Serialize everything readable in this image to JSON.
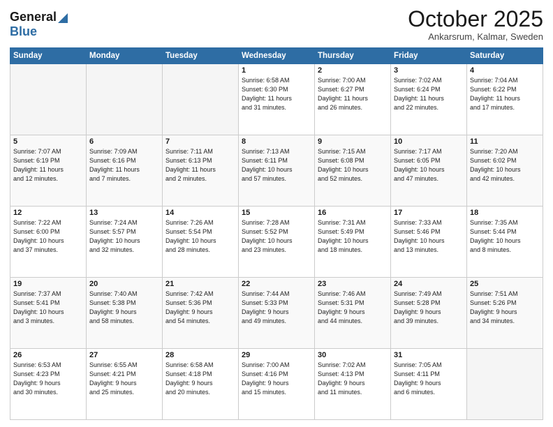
{
  "header": {
    "logo_general": "General",
    "logo_blue": "Blue",
    "month_title": "October 2025",
    "location": "Ankarsrum, Kalmar, Sweden"
  },
  "days_of_week": [
    "Sunday",
    "Monday",
    "Tuesday",
    "Wednesday",
    "Thursday",
    "Friday",
    "Saturday"
  ],
  "weeks": [
    [
      {
        "day": "",
        "info": ""
      },
      {
        "day": "",
        "info": ""
      },
      {
        "day": "",
        "info": ""
      },
      {
        "day": "1",
        "info": "Sunrise: 6:58 AM\nSunset: 6:30 PM\nDaylight: 11 hours\nand 31 minutes."
      },
      {
        "day": "2",
        "info": "Sunrise: 7:00 AM\nSunset: 6:27 PM\nDaylight: 11 hours\nand 26 minutes."
      },
      {
        "day": "3",
        "info": "Sunrise: 7:02 AM\nSunset: 6:24 PM\nDaylight: 11 hours\nand 22 minutes."
      },
      {
        "day": "4",
        "info": "Sunrise: 7:04 AM\nSunset: 6:22 PM\nDaylight: 11 hours\nand 17 minutes."
      }
    ],
    [
      {
        "day": "5",
        "info": "Sunrise: 7:07 AM\nSunset: 6:19 PM\nDaylight: 11 hours\nand 12 minutes."
      },
      {
        "day": "6",
        "info": "Sunrise: 7:09 AM\nSunset: 6:16 PM\nDaylight: 11 hours\nand 7 minutes."
      },
      {
        "day": "7",
        "info": "Sunrise: 7:11 AM\nSunset: 6:13 PM\nDaylight: 11 hours\nand 2 minutes."
      },
      {
        "day": "8",
        "info": "Sunrise: 7:13 AM\nSunset: 6:11 PM\nDaylight: 10 hours\nand 57 minutes."
      },
      {
        "day": "9",
        "info": "Sunrise: 7:15 AM\nSunset: 6:08 PM\nDaylight: 10 hours\nand 52 minutes."
      },
      {
        "day": "10",
        "info": "Sunrise: 7:17 AM\nSunset: 6:05 PM\nDaylight: 10 hours\nand 47 minutes."
      },
      {
        "day": "11",
        "info": "Sunrise: 7:20 AM\nSunset: 6:02 PM\nDaylight: 10 hours\nand 42 minutes."
      }
    ],
    [
      {
        "day": "12",
        "info": "Sunrise: 7:22 AM\nSunset: 6:00 PM\nDaylight: 10 hours\nand 37 minutes."
      },
      {
        "day": "13",
        "info": "Sunrise: 7:24 AM\nSunset: 5:57 PM\nDaylight: 10 hours\nand 32 minutes."
      },
      {
        "day": "14",
        "info": "Sunrise: 7:26 AM\nSunset: 5:54 PM\nDaylight: 10 hours\nand 28 minutes."
      },
      {
        "day": "15",
        "info": "Sunrise: 7:28 AM\nSunset: 5:52 PM\nDaylight: 10 hours\nand 23 minutes."
      },
      {
        "day": "16",
        "info": "Sunrise: 7:31 AM\nSunset: 5:49 PM\nDaylight: 10 hours\nand 18 minutes."
      },
      {
        "day": "17",
        "info": "Sunrise: 7:33 AM\nSunset: 5:46 PM\nDaylight: 10 hours\nand 13 minutes."
      },
      {
        "day": "18",
        "info": "Sunrise: 7:35 AM\nSunset: 5:44 PM\nDaylight: 10 hours\nand 8 minutes."
      }
    ],
    [
      {
        "day": "19",
        "info": "Sunrise: 7:37 AM\nSunset: 5:41 PM\nDaylight: 10 hours\nand 3 minutes."
      },
      {
        "day": "20",
        "info": "Sunrise: 7:40 AM\nSunset: 5:38 PM\nDaylight: 9 hours\nand 58 minutes."
      },
      {
        "day": "21",
        "info": "Sunrise: 7:42 AM\nSunset: 5:36 PM\nDaylight: 9 hours\nand 54 minutes."
      },
      {
        "day": "22",
        "info": "Sunrise: 7:44 AM\nSunset: 5:33 PM\nDaylight: 9 hours\nand 49 minutes."
      },
      {
        "day": "23",
        "info": "Sunrise: 7:46 AM\nSunset: 5:31 PM\nDaylight: 9 hours\nand 44 minutes."
      },
      {
        "day": "24",
        "info": "Sunrise: 7:49 AM\nSunset: 5:28 PM\nDaylight: 9 hours\nand 39 minutes."
      },
      {
        "day": "25",
        "info": "Sunrise: 7:51 AM\nSunset: 5:26 PM\nDaylight: 9 hours\nand 34 minutes."
      }
    ],
    [
      {
        "day": "26",
        "info": "Sunrise: 6:53 AM\nSunset: 4:23 PM\nDaylight: 9 hours\nand 30 minutes."
      },
      {
        "day": "27",
        "info": "Sunrise: 6:55 AM\nSunset: 4:21 PM\nDaylight: 9 hours\nand 25 minutes."
      },
      {
        "day": "28",
        "info": "Sunrise: 6:58 AM\nSunset: 4:18 PM\nDaylight: 9 hours\nand 20 minutes."
      },
      {
        "day": "29",
        "info": "Sunrise: 7:00 AM\nSunset: 4:16 PM\nDaylight: 9 hours\nand 15 minutes."
      },
      {
        "day": "30",
        "info": "Sunrise: 7:02 AM\nSunset: 4:13 PM\nDaylight: 9 hours\nand 11 minutes."
      },
      {
        "day": "31",
        "info": "Sunrise: 7:05 AM\nSunset: 4:11 PM\nDaylight: 9 hours\nand 6 minutes."
      },
      {
        "day": "",
        "info": ""
      }
    ]
  ]
}
